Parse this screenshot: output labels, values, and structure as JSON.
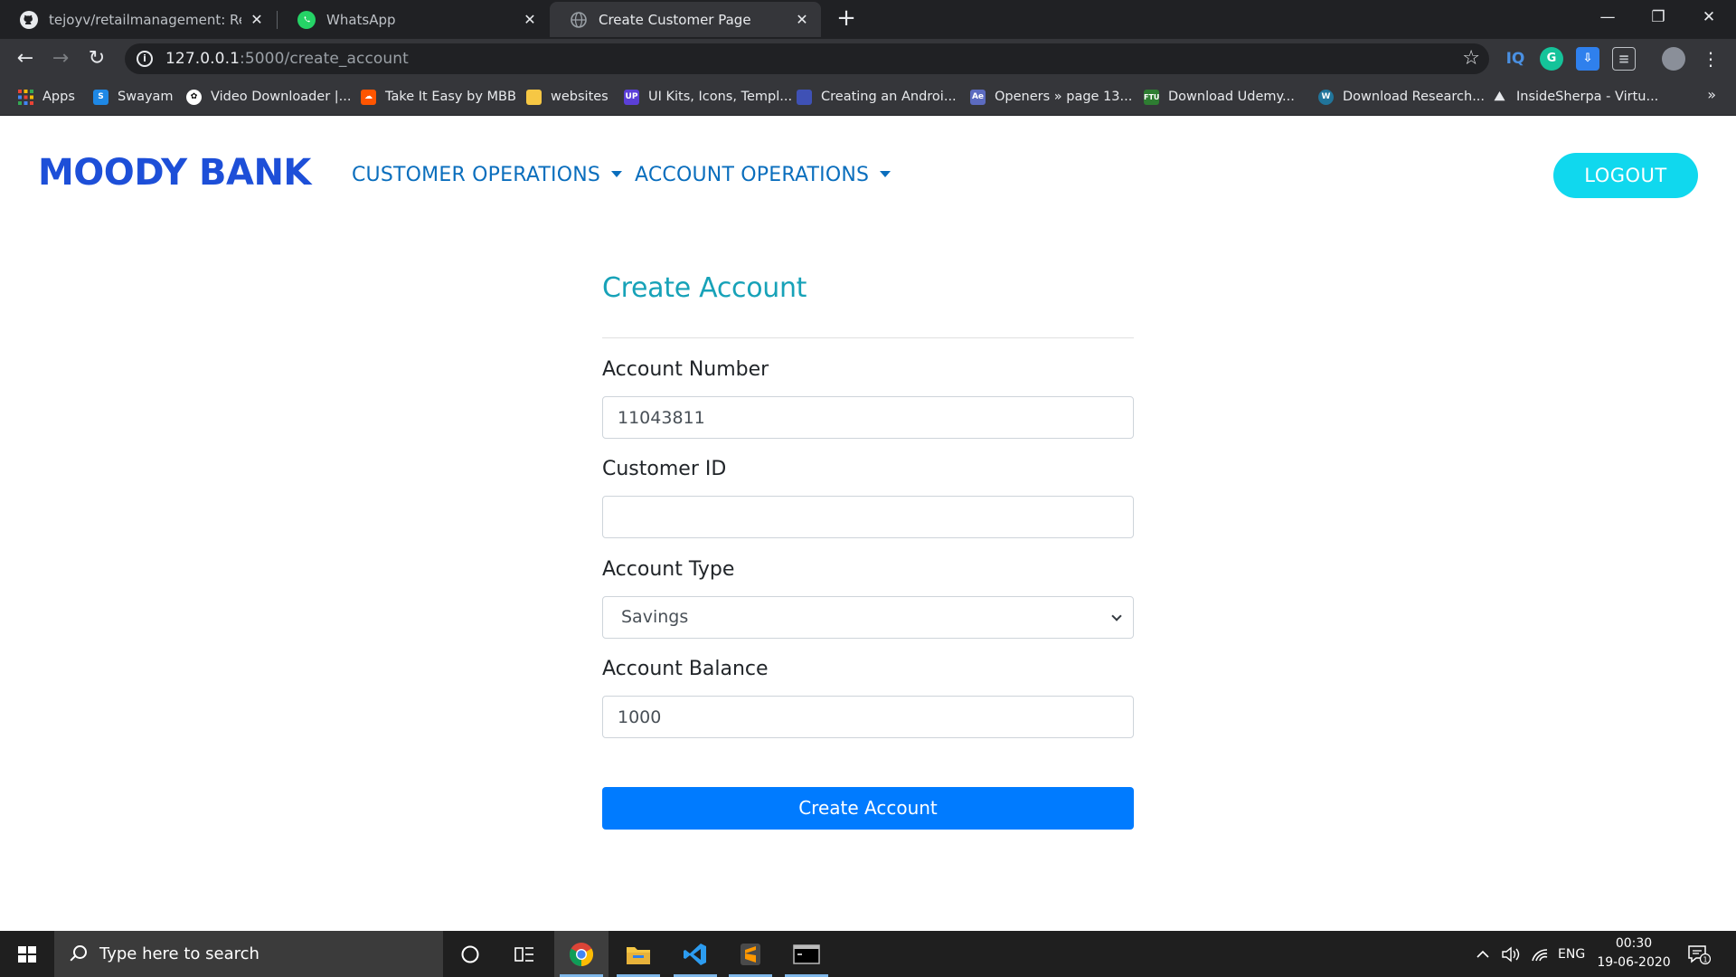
{
  "browser": {
    "tabs": [
      {
        "title": "tejoyv/retailmanagement: Retail Management",
        "icon": "github-icon"
      },
      {
        "title": "WhatsApp",
        "icon": "whatsapp-icon"
      },
      {
        "title": "Create Customer Page",
        "icon": "globe-icon"
      }
    ],
    "address": {
      "host": "127.0.0.1",
      "path": ":5000/create_account"
    },
    "bookmarks": [
      {
        "label": "Apps",
        "color": "#ea4335"
      },
      {
        "label": "Swayam",
        "color": "#1e88e5"
      },
      {
        "label": "Video Downloader |...",
        "color": "#ffffff"
      },
      {
        "label": "Take It Easy by MBB",
        "color": "#ff5500"
      },
      {
        "label": "websites",
        "color": "#f6c744"
      },
      {
        "label": "UI Kits, Icons, Templ...",
        "color": "#5b3fd8"
      },
      {
        "label": "Creating an Androi...",
        "color": "#3f51b5"
      },
      {
        "label": "Openers » page 13...",
        "color": "#5c6bc0"
      },
      {
        "label": "Download Udemy...",
        "color": "#2e7d32"
      },
      {
        "label": "Download Research...",
        "color": "#21759b"
      },
      {
        "label": "InsideSherpa - Virtu...",
        "color": "#e8eaed"
      }
    ],
    "bookmarks_more": "»",
    "extensions": [
      "IQ",
      "G",
      "⇩",
      "≡"
    ]
  },
  "app": {
    "brand": "MOODY BANK",
    "nav": [
      {
        "label": "CUSTOMER OPERATIONS"
      },
      {
        "label": "ACCOUNT OPERATIONS"
      }
    ],
    "logout": "LOGOUT"
  },
  "form": {
    "title": "Create Account",
    "fields": [
      {
        "label": "Account Number",
        "value": "11043811"
      },
      {
        "label": "Customer ID",
        "value": ""
      },
      {
        "label": "Account Type",
        "value": "Savings"
      },
      {
        "label": "Account Balance",
        "value": "1000"
      }
    ],
    "submit": "Create Account"
  },
  "taskbar": {
    "search_placeholder": "Type here to search",
    "language": "ENG",
    "time": "00:30",
    "date": "19-06-2020",
    "notifications": "1"
  },
  "colors": {
    "brand": "#1d4fd8",
    "nav_link": "#0a6ebd",
    "logout_bg": "#10d8ee",
    "form_title": "#17a2b8",
    "primary_button": "#007bff"
  }
}
